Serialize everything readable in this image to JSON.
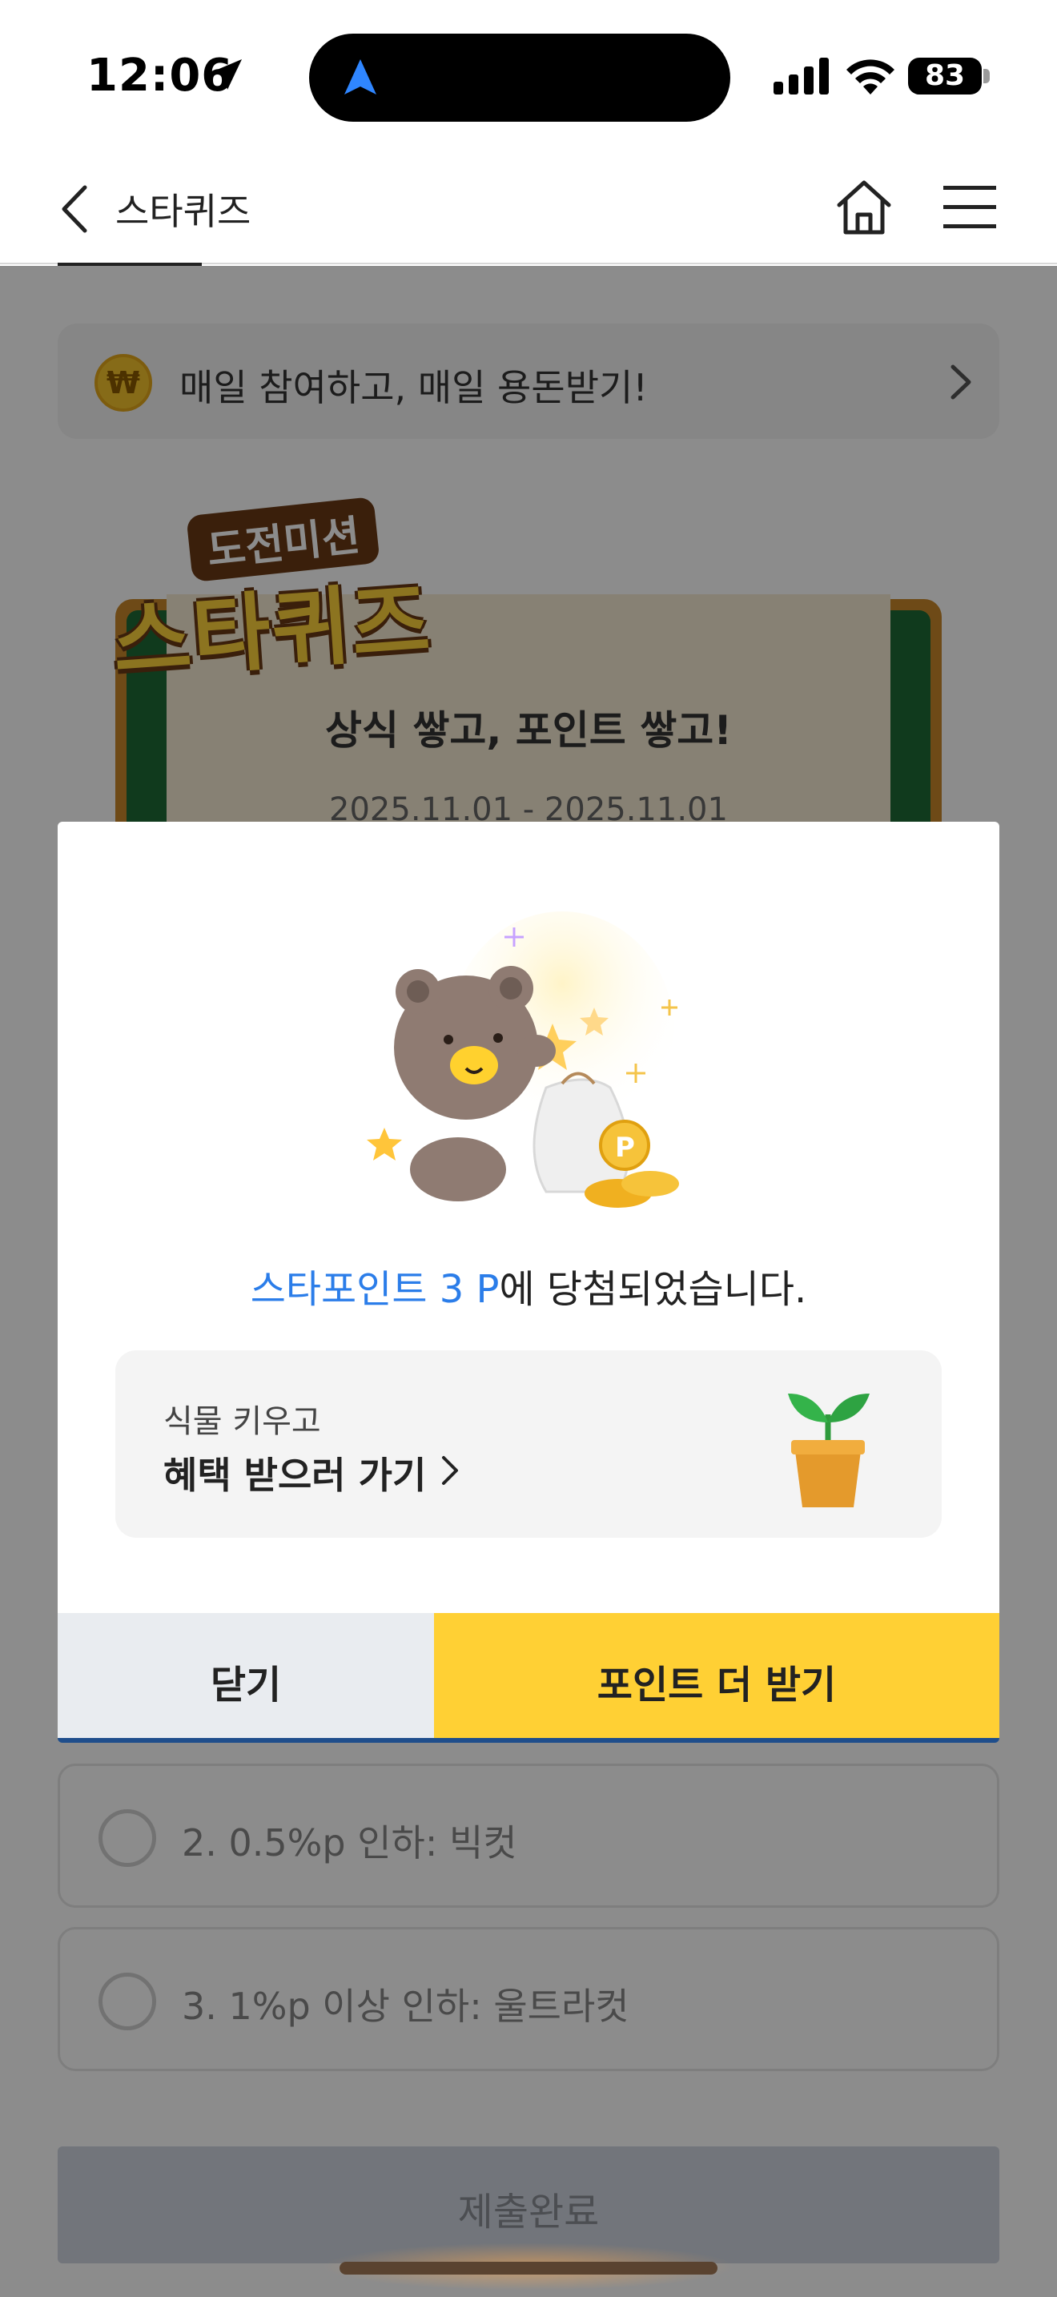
{
  "status_bar": {
    "time": "12:06",
    "battery": "83",
    "icons": [
      "location-arrow-icon",
      "signal-icon",
      "wifi-icon",
      "battery-icon"
    ]
  },
  "nav": {
    "title": "스타퀴즈",
    "icons": [
      "back-chevron-icon",
      "home-icon",
      "hamburger-menu-icon"
    ]
  },
  "promo": {
    "text": "매일 참여하고, 매일 용돈받기!",
    "coin_symbol": "₩"
  },
  "hero": {
    "logo_top": "도전미션",
    "logo_main": "스타퀴즈",
    "subtitle": "상식 쌓고, 포인트 쌓고!",
    "date_range": "2025.11.01 - 2025.11.01"
  },
  "options": [
    {
      "label": "2. 0.5%p 인하: 빅컷"
    },
    {
      "label": "3. 1%p 이상 인하: 울트라컷"
    }
  ],
  "submit_label": "제출완료",
  "modal": {
    "win_highlight": "스타포인트 3 P",
    "win_rest": "에 당첨되었습니다.",
    "benefit_small": "식물 키우고",
    "benefit_big": "혜택 받으러 가기",
    "close_label": "닫기",
    "more_label": "포인트 더 받기"
  },
  "colors": {
    "accent_blue": "#2b7de9",
    "button_yellow": "#ffd034",
    "close_gray": "#e9ecf0"
  }
}
